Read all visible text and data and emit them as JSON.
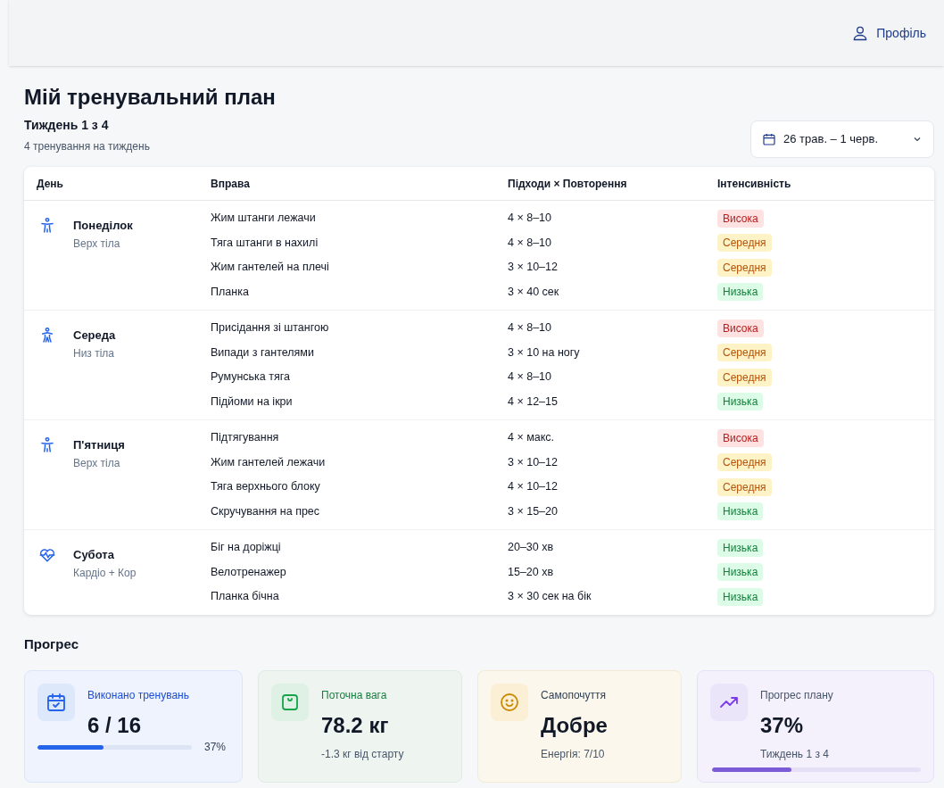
{
  "header": {
    "profile_link": "Профіль"
  },
  "page": {
    "title": "Мій тренувальний план",
    "week": "Тиждень 1 з 4",
    "subtitle": "4 тренування на тиждень",
    "date_range": "26 трав. – 1 черв."
  },
  "table": {
    "columns": [
      "День",
      "Вправа",
      "Підходи × Повторення",
      "Інтенсивність"
    ],
    "groups": [
      {
        "day": "Понеділок",
        "focus": "Верх тіла",
        "kind": "upper",
        "rows": [
          {
            "exercise": "Жим штанги лежачи",
            "sets": "4 × 8–10",
            "intensity": "Висока",
            "kind": "high"
          },
          {
            "exercise": "Тяга штанги в нахилі",
            "sets": "4 × 8–10",
            "intensity": "Середня",
            "kind": "medium"
          },
          {
            "exercise": "Жим гантелей на плечі",
            "sets": "3 × 10–12",
            "intensity": "Середня",
            "kind": "medium"
          },
          {
            "exercise": "Планка",
            "sets": "3 × 40 сек",
            "intensity": "Низька",
            "kind": "low"
          }
        ]
      },
      {
        "day": "Середа",
        "focus": "Низ тіла",
        "kind": "lower",
        "rows": [
          {
            "exercise": "Присідання зі штангою",
            "sets": "4 × 8–10",
            "intensity": "Висока",
            "kind": "high"
          },
          {
            "exercise": "Випади з гантелями",
            "sets": "3 × 10 на ногу",
            "intensity": "Середня",
            "kind": "medium"
          },
          {
            "exercise": "Румунська тяга",
            "sets": "4 × 8–10",
            "intensity": "Середня",
            "kind": "medium"
          },
          {
            "exercise": "Підйоми на ікри",
            "sets": "4 × 12–15",
            "intensity": "Низька",
            "kind": "low"
          }
        ]
      },
      {
        "day": "П'ятниця",
        "focus": "Верх тіла",
        "kind": "upper",
        "rows": [
          {
            "exercise": "Підтягування",
            "sets": "4 × макс.",
            "intensity": "Висока",
            "kind": "high"
          },
          {
            "exercise": "Жим гантелей лежачи",
            "sets": "3 × 10–12",
            "intensity": "Середня",
            "kind": "medium"
          },
          {
            "exercise": "Тяга верхнього блоку",
            "sets": "4 × 10–12",
            "intensity": "Середня",
            "kind": "medium"
          },
          {
            "exercise": "Скручування на прес",
            "sets": "3 × 15–20",
            "intensity": "Низька",
            "kind": "low"
          }
        ]
      },
      {
        "day": "Субота",
        "focus": "Кардіо + Кор",
        "kind": "cardio",
        "rows": [
          {
            "exercise": "Біг на доріжці",
            "sets": "20–30 хв",
            "intensity": "Низька",
            "kind": "low"
          },
          {
            "exercise": "Велотренажер",
            "sets": "15–20 хв",
            "intensity": "Низька",
            "kind": "low"
          },
          {
            "exercise": "Планка бічна",
            "sets": "3 × 30 сек на бік",
            "intensity": "Низька",
            "kind": "low"
          }
        ]
      }
    ]
  },
  "progress": {
    "title": "Прогрес",
    "cards": [
      {
        "kind": "workouts",
        "label": "Виконано тренувань",
        "value": "6 / 16",
        "level": 0.43,
        "reading": "37%"
      },
      {
        "kind": "weight",
        "label": "Поточна вага",
        "value": "78.2 кг",
        "note": "-1.3 кг від старту"
      },
      {
        "kind": "mood",
        "label": "Самопочуття",
        "value": "Добре",
        "note": "Енергія: 7/10"
      },
      {
        "kind": "plan",
        "label": "Прогрес плану",
        "value": "37%",
        "note": "Тиждень 1 з 4",
        "level": 0.38
      }
    ]
  }
}
